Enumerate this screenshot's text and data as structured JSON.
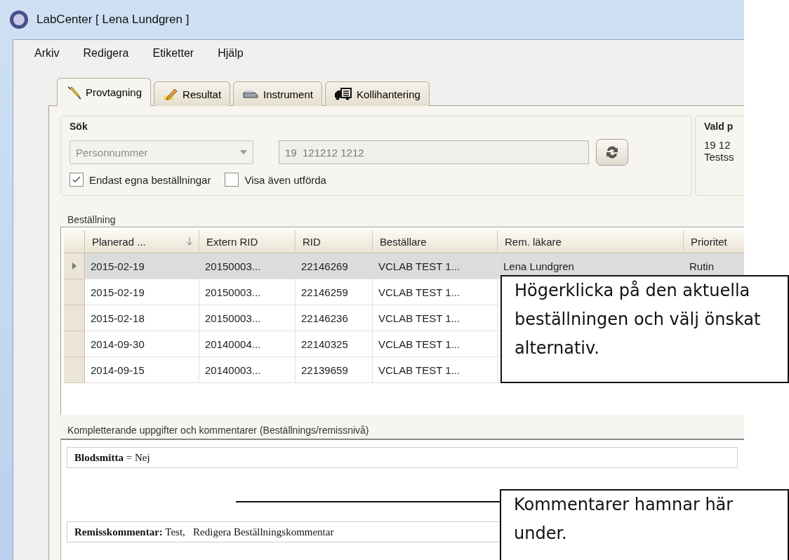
{
  "window": {
    "title": "LabCenter [ Lena Lundgren ]"
  },
  "menu": [
    "Arkiv",
    "Redigera",
    "Etiketter",
    "Hjälp"
  ],
  "tabs": [
    {
      "label": "Provtagning",
      "selected": true
    },
    {
      "label": "Resultat",
      "selected": false
    },
    {
      "label": "Instrument",
      "selected": false
    },
    {
      "label": "Kollihantering",
      "selected": false
    }
  ],
  "search": {
    "title": "Sök",
    "id_type": {
      "value": "Personnummer",
      "disabled": true
    },
    "id_field": {
      "value": "19  121212 1212"
    },
    "checkboxes": [
      {
        "label": "Endast egna beställningar",
        "checked": true
      },
      {
        "label": "Visa även utförda",
        "checked": false
      }
    ]
  },
  "selected_patient": {
    "title": "Vald p",
    "lines": [
      "19  12",
      "Testss"
    ]
  },
  "orders": {
    "title": "Beställning",
    "columns": [
      {
        "label": "Planerad ...",
        "sorted": true
      },
      {
        "label": "Extern RID",
        "sorted": false
      },
      {
        "label": "RID",
        "sorted": false
      },
      {
        "label": "Beställare",
        "sorted": false
      },
      {
        "label": "Rem. läkare",
        "sorted": false
      },
      {
        "label": "Prioritet",
        "sorted": false
      }
    ],
    "rows": [
      {
        "selected": true,
        "cells": [
          "2015-02-19",
          "20150003...",
          "22146269",
          "VCLAB TEST 1...",
          "Lena Lundgren",
          "Rutin"
        ]
      },
      {
        "selected": false,
        "cells": [
          "2015-02-19",
          "20150003...",
          "22146259",
          "VCLAB TEST 1..."
        ]
      },
      {
        "selected": false,
        "cells": [
          "2015-02-18",
          "20150003...",
          "22146236",
          "VCLAB TEST 1..."
        ]
      },
      {
        "selected": false,
        "cells": [
          "2014-09-30",
          "20140004...",
          "22140325",
          "VCLAB TEST 1..."
        ]
      },
      {
        "selected": false,
        "cells": [
          "2014-09-15",
          "20140003...",
          "22139659",
          "VCLAB TEST 1..."
        ]
      }
    ]
  },
  "comments": {
    "title": "Kompletterande uppgifter och kommentarer (Beställnings/remissnivå)",
    "entries": [
      "**Blodsmitta** = Nej",
      "**Remisskommentar:** Test,   Redigera Beställningskommentar"
    ]
  },
  "callouts": [
    "Högerklicka på den aktuella beställningen och välj önskat alternativ.",
    "Kommentarer hamnar här under."
  ]
}
